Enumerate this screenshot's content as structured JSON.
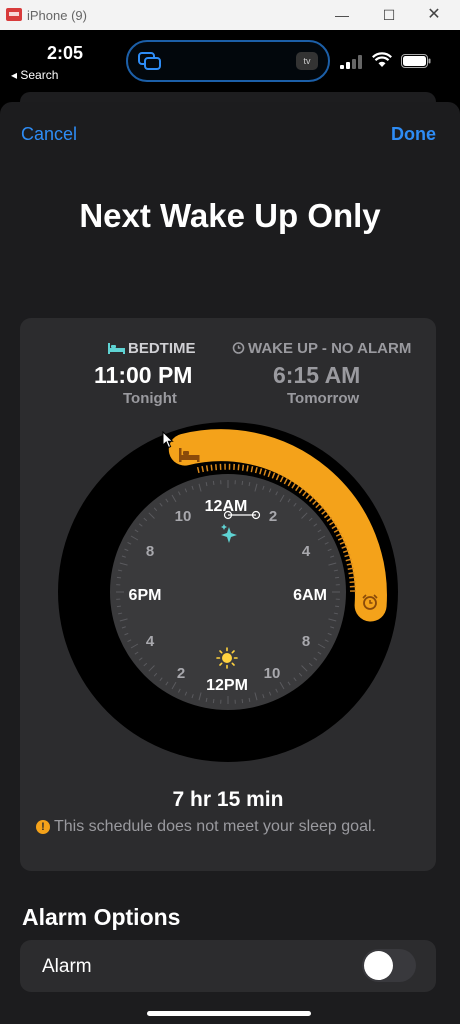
{
  "window": {
    "title": "iPhone (9)",
    "controls": {
      "minimize": "—",
      "maximize": "☐",
      "close": "✕"
    }
  },
  "status_bar": {
    "time": "2:05",
    "back": "◂ Search",
    "island_app": "tv"
  },
  "sheet": {
    "cancel": "Cancel",
    "done": "Done",
    "title": "Next Wake Up Only",
    "bedtime": {
      "label": "BEDTIME",
      "time": "11:00 PM",
      "day": "Tonight"
    },
    "wakeup": {
      "label": "WAKE UP - NO ALARM",
      "time": "6:15 AM",
      "day": "Tomorrow"
    },
    "clock_labels": {
      "twelve_am": "12AM",
      "two": "2",
      "four": "4",
      "six_am": "6AM",
      "eight": "8",
      "ten": "10",
      "twelve_pm": "12PM",
      "two_pm": "2",
      "four_pm": "4",
      "six_pm": "6PM",
      "eight_pm": "8",
      "ten_pm": "10"
    },
    "duration": "7 hr 15 min",
    "warning": "This schedule does not meet your sleep goal.",
    "alarm_options_title": "Alarm Options",
    "alarm_label": "Alarm",
    "alarm_on": false
  },
  "colors": {
    "accent": "#2e8cf5",
    "sleep_arc": "#f4a21a",
    "sheet_bg": "#1c1c1e",
    "card_bg": "#2c2c2e"
  }
}
